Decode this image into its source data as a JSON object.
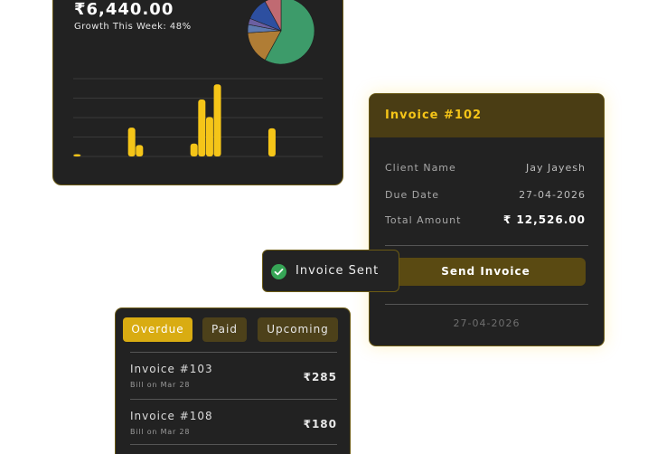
{
  "revenue": {
    "amount": "₹6,440.00",
    "growth_text": "Growth This Week: 48%"
  },
  "chart_data": [
    {
      "type": "pie",
      "values": [
        0.58,
        0.16,
        0.04,
        0.03,
        0.11,
        0.08
      ],
      "colors": [
        "#3d9b6a",
        "#b07d35",
        "#5d7ab0",
        "#6b5fa1",
        "#2d4fa0",
        "#c06a72"
      ]
    },
    {
      "type": "bar",
      "values": [
        3,
        0,
        0,
        0,
        0,
        0,
        0,
        38,
        15,
        0,
        0,
        0,
        0,
        0,
        0,
        17,
        75,
        52,
        95,
        0,
        0,
        0,
        0,
        0,
        0,
        37,
        0,
        0,
        0,
        0,
        0,
        0
      ],
      "ylim": [
        0,
        100
      ],
      "color": "#f5c518",
      "gridlines": 5
    }
  ],
  "invoice": {
    "title": "Invoice #102",
    "client_label": "Client Name",
    "client_value": "Jay Jayesh",
    "due_label": "Due Date",
    "due_value": "27-04-2026",
    "total_label": "Total Amount",
    "total_value": "₹ 12,526.00",
    "send_button": "Send Invoice",
    "footer_date": "27-04-2026"
  },
  "toast": {
    "text": "Invoice Sent",
    "icon": "check-circle-icon",
    "color": "#36a556"
  },
  "bills": {
    "tabs": [
      "Overdue",
      "Paid",
      "Upcoming"
    ],
    "items": [
      {
        "title": "Invoice #103",
        "sub": "Bill on Mar 28",
        "amount": "₹285"
      },
      {
        "title": "Invoice #108",
        "sub": "Bill on Mar 28",
        "amount": "₹180"
      }
    ]
  },
  "colors": {
    "accent": "#f5c518",
    "card": "#222222",
    "border": "#6b5a14"
  }
}
